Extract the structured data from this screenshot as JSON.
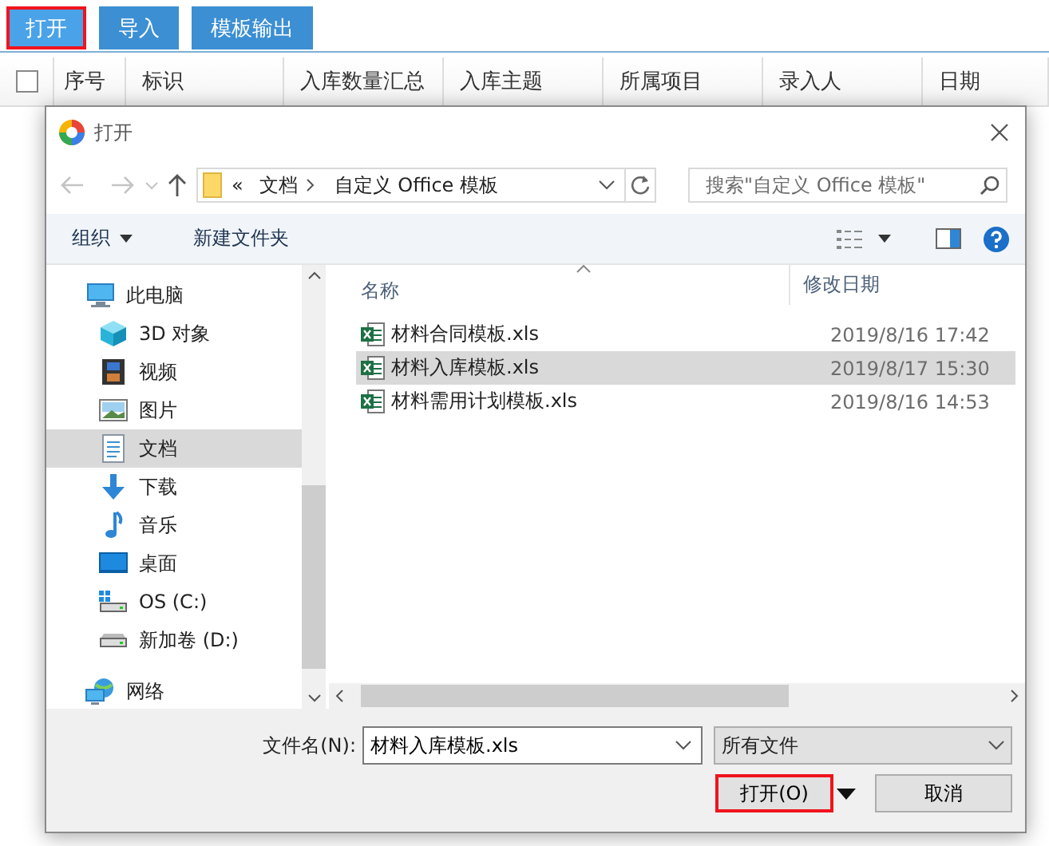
{
  "toolbar": {
    "buttons": [
      {
        "label": "打开",
        "highlighted": true
      },
      {
        "label": "导入",
        "highlighted": false
      },
      {
        "label": "模板输出",
        "highlighted": false
      }
    ]
  },
  "table": {
    "select_all": {
      "checked": false
    },
    "columns": [
      "序号",
      "标识",
      "入库数量汇总",
      "入库主题",
      "所属项目",
      "录入人",
      "日期"
    ]
  },
  "dialog": {
    "title": "打开",
    "address": {
      "overflow": "«",
      "path": [
        "文档",
        "自定义 Office 模板"
      ]
    },
    "search": {
      "placeholder": "搜索\"自定义 Office 模板\""
    },
    "commands": [
      {
        "label": "组织",
        "kind": "menu"
      },
      {
        "label": "新建文件夹",
        "kind": "plain"
      }
    ],
    "sidebar": {
      "items": [
        {
          "label": "此电脑",
          "kind": "computer",
          "selected": false,
          "children": [
            {
              "label": "3D 对象",
              "kind": "cube",
              "selected": false
            },
            {
              "label": "视频",
              "kind": "film",
              "selected": false
            },
            {
              "label": "图片",
              "kind": "image",
              "selected": false
            },
            {
              "label": "文档",
              "kind": "document",
              "selected": true
            },
            {
              "label": "下载",
              "kind": "download",
              "selected": false
            },
            {
              "label": "音乐",
              "kind": "music",
              "selected": false
            },
            {
              "label": "桌面",
              "kind": "desktop",
              "selected": false
            },
            {
              "label": "OS (C:)",
              "kind": "osdrive",
              "selected": false
            },
            {
              "label": "新加卷 (D:)",
              "kind": "drive",
              "selected": false
            }
          ]
        },
        {
          "label": "网络",
          "kind": "network",
          "selected": false
        }
      ]
    },
    "files": {
      "columns": [
        "名称",
        "修改日期"
      ],
      "rows": [
        {
          "name": "材料合同模板.xls",
          "modified": "2019/8/16 17:42",
          "selected": false
        },
        {
          "name": "材料入库模板.xls",
          "modified": "2019/8/17 15:30",
          "selected": true
        },
        {
          "name": "材料需用计划模板.xls",
          "modified": "2019/8/16 14:53",
          "selected": false
        }
      ]
    },
    "filename": {
      "label": "文件名(N):",
      "value": "材料入库模板.xls"
    },
    "filetype": {
      "value": "所有文件"
    },
    "buttons": [
      {
        "label": "打开(O)",
        "kind": "split",
        "highlighted": true
      },
      {
        "label": "取消",
        "kind": "plain",
        "highlighted": false
      }
    ]
  }
}
